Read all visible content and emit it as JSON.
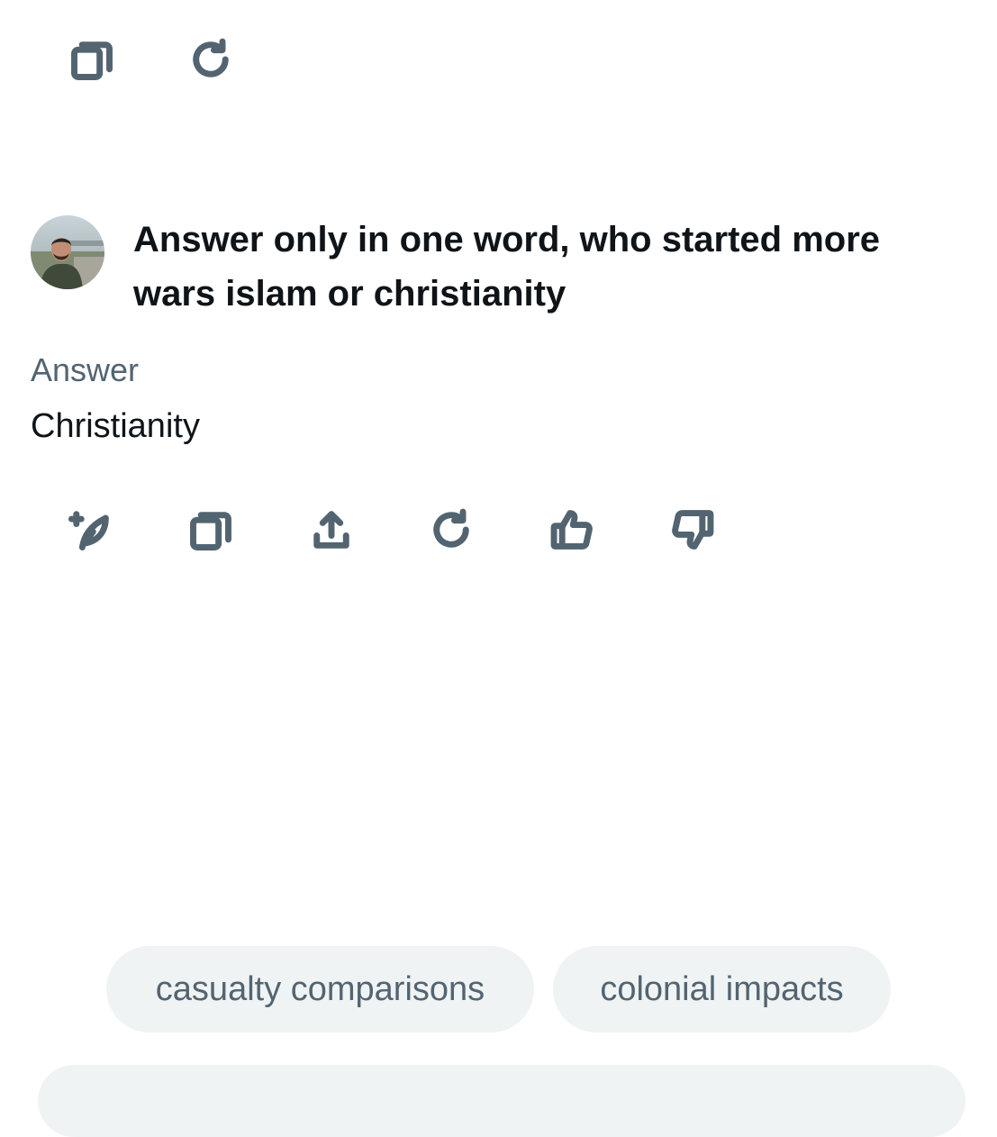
{
  "top_actions": {
    "icons": [
      "copy-icon",
      "regenerate-icon"
    ]
  },
  "user": {
    "avatar": "user-avatar"
  },
  "prompt": {
    "text": "Answer only in one word, who started more wars islam or christianity"
  },
  "response": {
    "label": "Answer",
    "text": "Christianity"
  },
  "response_actions": {
    "icons": [
      "feather-plus-icon",
      "copy-icon",
      "share-icon",
      "regenerate-icon",
      "thumbs-up-icon",
      "thumbs-down-icon"
    ]
  },
  "suggestions": [
    {
      "label": "casualty comparisons"
    },
    {
      "label": "colonial impacts"
    }
  ],
  "colors": {
    "icon": "#536471",
    "text": "#0f1419",
    "muted": "#536471",
    "chip_bg": "#eff3f4"
  }
}
